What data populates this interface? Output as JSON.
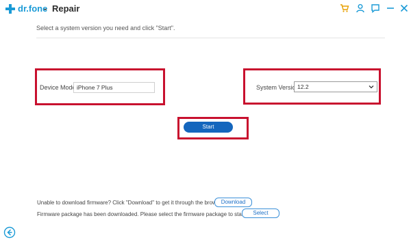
{
  "app": {
    "brand": "dr.fone",
    "separator": "-",
    "title": "Repair"
  },
  "titlebar_icons": [
    "cart-icon",
    "user-icon",
    "feedback-icon",
    "minimize-icon",
    "close-icon"
  ],
  "instruction": "Select a system version you need and click \"Start\".",
  "device_model": {
    "label": "Device Model:",
    "value": "iPhone 7 Plus"
  },
  "system_version": {
    "label": "System Version:",
    "selected": "12.2"
  },
  "start_button": "Start",
  "download_note": {
    "text": "Unable to download firmware? Click \"Download\" to get it through the browser.",
    "button": "Download"
  },
  "select_note": {
    "text": "Firmware package has been downloaded. Please select the firmware package to start repair.",
    "button": "Select"
  },
  "colors": {
    "brand": "#1a9ad6",
    "accent_icons": "#e8a000",
    "primary_button": "#1466bd",
    "highlight_box": "#c8102e"
  }
}
